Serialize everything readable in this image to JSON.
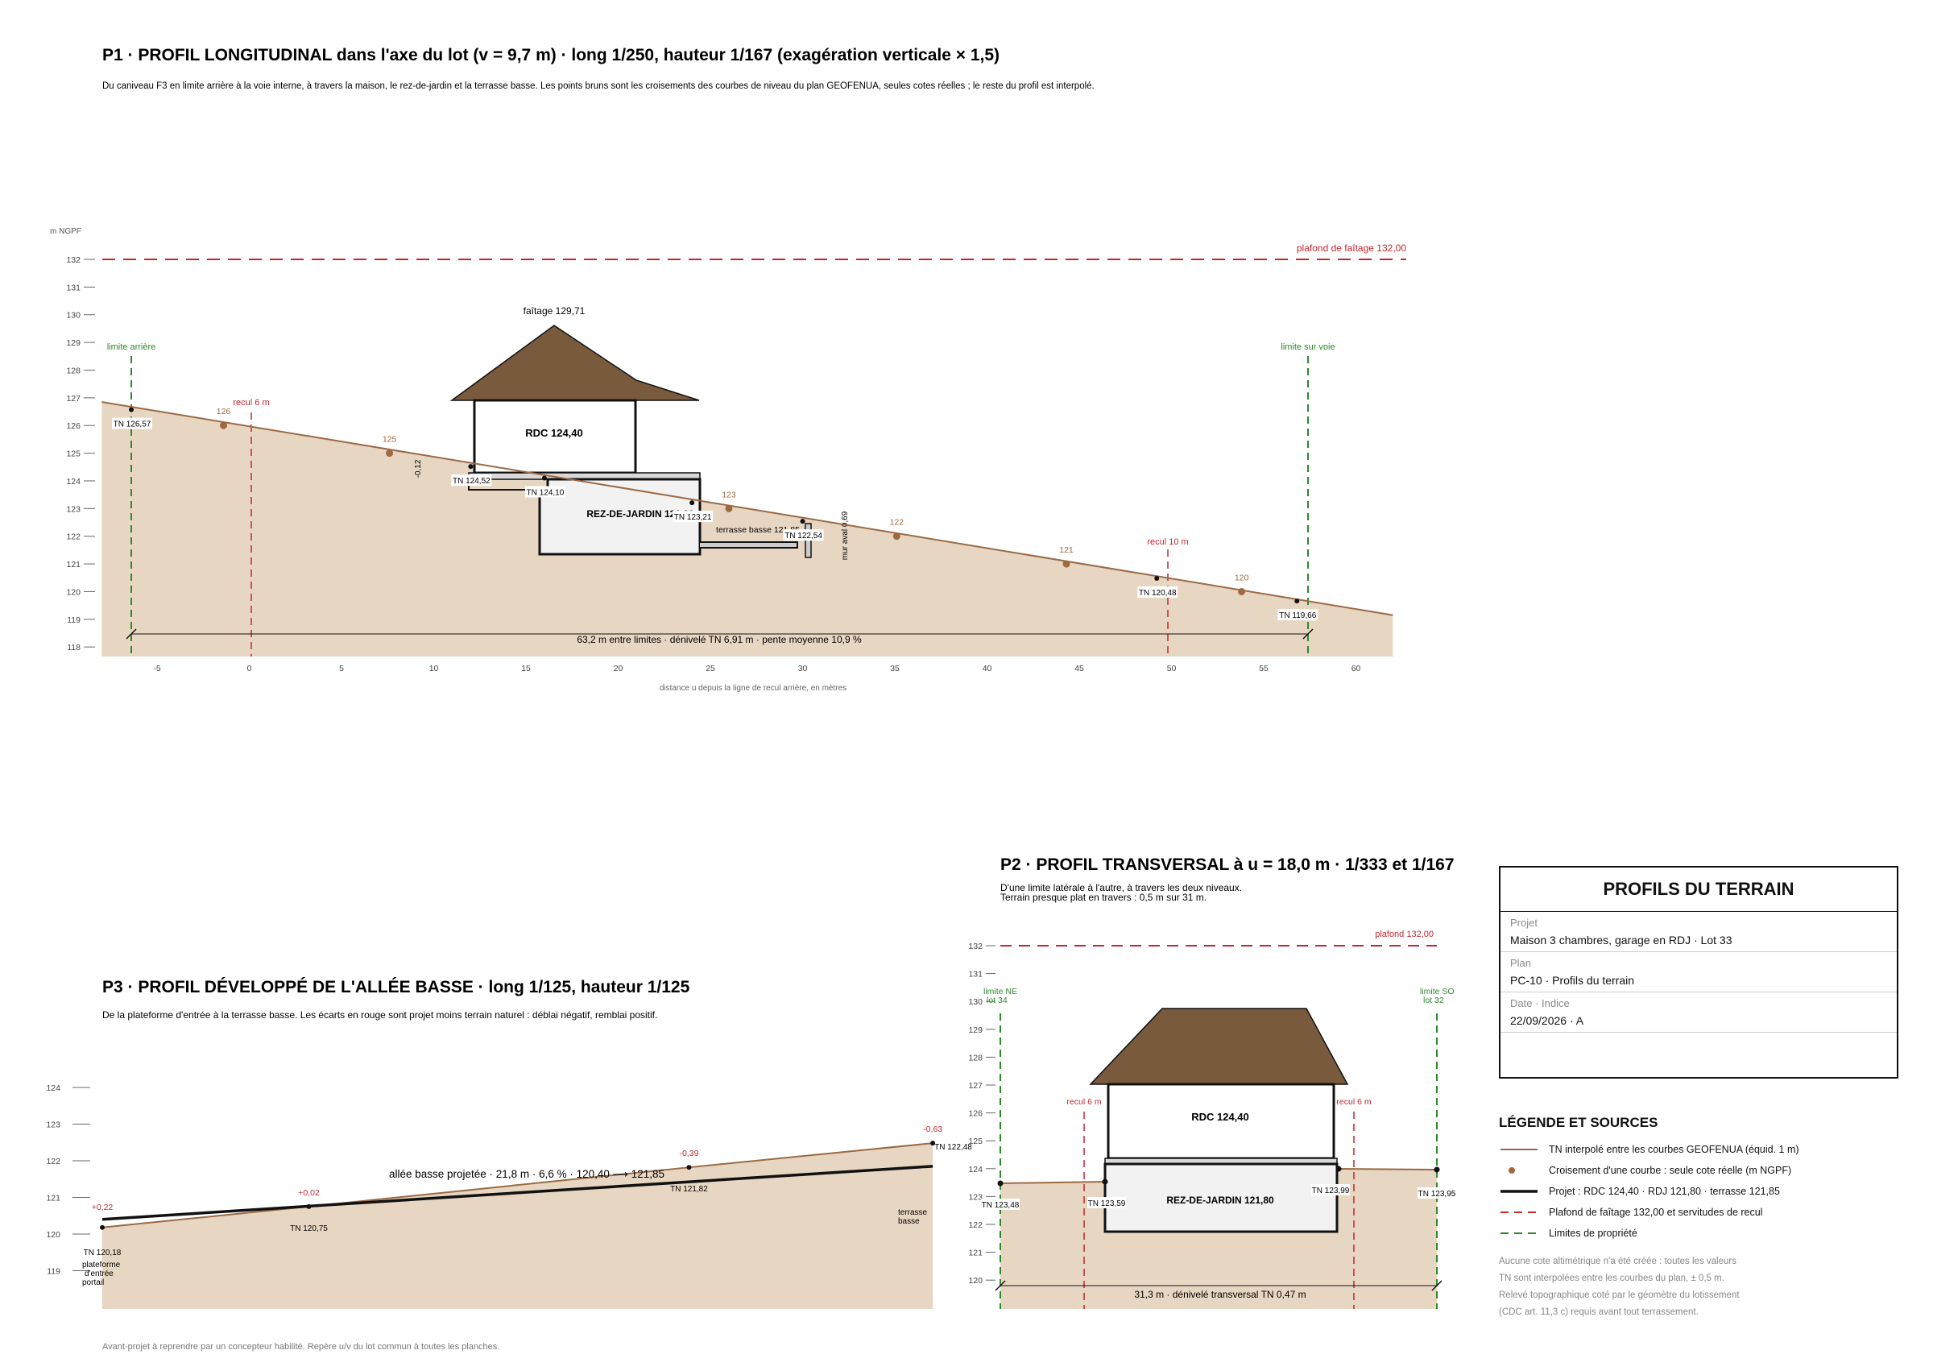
{
  "colors": {
    "tn_line": "#9b6a45",
    "ground_fill": "#e7d6c2",
    "roof": "#7a5a3c",
    "red": "#c4262e",
    "green": "#2a8a2a",
    "project": "#111111"
  },
  "p1": {
    "title": "P1 · PROFIL LONGITUDINAL dans l'axe du lot (v = 9,7 m) · long 1/250, hauteur 1/167 (exagération verticale × 1,5)",
    "subtitle": "Du caniveau F3 en limite arrière à la voie interne, à travers la maison, le rez-de-jardin et la terrasse basse. Les points bruns sont les croisements des courbes de niveau du plan GEOFENUA, seules cotes réelles ; le reste du profil est interpolé.",
    "unit": "m NGPF",
    "x_axis_label": "distance u depuis la ligne de recul arrière, en mètres",
    "chart_data": {
      "type": "line",
      "x_ticks": [
        -5,
        0,
        5,
        10,
        15,
        20,
        25,
        30,
        35,
        40,
        45,
        50,
        55,
        60
      ],
      "y_ticks": [
        118,
        119,
        120,
        121,
        122,
        123,
        124,
        125,
        126,
        127,
        128,
        129,
        130,
        131,
        132
      ],
      "xlim": [
        -8,
        62
      ],
      "ylim": [
        117.5,
        132.5
      ],
      "tn_line": {
        "x": [
          -8,
          62
        ],
        "y": [
          126.85,
          119.15
        ]
      },
      "contour_points": [
        {
          "x": -1.4,
          "y": 126,
          "label": "126"
        },
        {
          "x": 7.6,
          "y": 125,
          "label": "125"
        },
        {
          "x": 26,
          "y": 123,
          "label": "123"
        },
        {
          "x": 35.1,
          "y": 122,
          "label": "122"
        },
        {
          "x": 44.3,
          "y": 121,
          "label": "121"
        },
        {
          "x": 53.8,
          "y": 120,
          "label": "120"
        }
      ],
      "tn_labels": [
        {
          "x": -6.4,
          "y": 126.57,
          "label": "TN 126,57"
        },
        {
          "x": 12,
          "y": 124.52,
          "label": "TN 124,52"
        },
        {
          "x": 16,
          "y": 124.1,
          "label": "TN 124,10"
        },
        {
          "x": 24,
          "y": 123.21,
          "label": "TN 123,21"
        },
        {
          "x": 30,
          "y": 122.54,
          "label": "TN 122,54"
        },
        {
          "x": 49.2,
          "y": 120.48,
          "label": "TN 120,48"
        },
        {
          "x": 56.8,
          "y": 119.66,
          "label": "TN 119,66"
        }
      ],
      "cap_label": "plafond de faîtage 132,00",
      "cap": 132,
      "ridge_label": "faîtage 129,71",
      "ridge": 129.71,
      "rdc_label": "RDC 124,40",
      "rdj_label": "REZ-DE-JARDIN 121,80",
      "terrace_label": "terrasse basse 121,85",
      "wall_label": "mur aval 0,69",
      "cut_label": "-0,12",
      "limit_rear_label": "limite arrière",
      "limit_road_label": "limite sur voie",
      "recul_rear_label": "recul 6 m",
      "recul_road_label": "recul 10 m",
      "dimension_label": "63,2 m entre limites · dénivelé TN 6,91 m · pente moyenne 10,9 %"
    }
  },
  "p2": {
    "title": "P2 · PROFIL TRANSVERSAL à u = 18,0 m · 1/333 et 1/167",
    "subtitle_1": "D'une limite latérale à l'autre, à travers les deux niveaux.",
    "subtitle_2": "Terrain presque plat en travers : 0,5 m sur 31 m.",
    "chart_data": {
      "type": "line",
      "y_ticks": [
        120,
        121,
        122,
        123,
        124,
        125,
        126,
        127,
        128,
        129,
        130,
        131,
        132
      ],
      "ylim": [
        119,
        132.5
      ],
      "cap_label": "plafond 132,00",
      "limit_ne_label": "limite NE",
      "limit_ne_sub": "lot 34",
      "limit_so_label": "limite SO",
      "limit_so_sub": "lot 32",
      "recul_left_label": "recul 6 m",
      "recul_right_label": "recul 6 m",
      "rdc_label": "RDC 124,40",
      "rdj_label": "REZ-DE-JARDIN 121,80",
      "tn_labels": [
        "TN 123,48",
        "TN 123,59",
        "TN 123,99",
        "TN 123,95"
      ],
      "dimension_label": "31,3 m · dénivelé transversal TN 0,47 m"
    }
  },
  "p3": {
    "title": "P3 · PROFIL DÉVELOPPÉ DE L'ALLÉE BASSE · long 1/125, hauteur 1/125",
    "subtitle": "De la plateforme d'entrée à la terrasse basse. Les écarts en rouge sont projet moins terrain naturel : déblai négatif, remblai positif.",
    "chart_data": {
      "type": "line",
      "y_ticks": [
        119,
        120,
        121,
        122,
        123,
        124
      ],
      "ylim": [
        118.5,
        124.5
      ],
      "tn_points": [
        {
          "x": 0,
          "y": 120.18,
          "label": "TN 120,18"
        },
        {
          "x": 5.0,
          "y": 120.75,
          "label": "TN 120,75"
        },
        {
          "x": 14.2,
          "y": 121.82,
          "label": "TN 121,82"
        },
        {
          "x": 20.1,
          "y": 122.48,
          "label": "TN 122,48"
        }
      ],
      "project_points": [
        {
          "x": 0,
          "y": 120.4
        },
        {
          "x": 20.1,
          "y": 121.85
        }
      ],
      "deltas": [
        "+0,22",
        "+0,02",
        "-0,39",
        "-0,63"
      ],
      "allee_label": "allée basse projetée · 21,8 m · 6,6 % · 120,40 ⟶ 121,85",
      "start_label_1": "plateforme",
      "start_label_2": "d'entrée",
      "start_label_3": "portail",
      "end_label_1": "terrasse",
      "end_label_2": "basse"
    }
  },
  "footer": "Avant-projet à reprendre par un concepteur habilité. Repère u/v du lot commun à toutes les planches.",
  "cartouche": {
    "title": "PROFILS DU TERRAIN",
    "rows": [
      {
        "label": "Projet",
        "value": "Maison 3 chambres, garage en RDJ · Lot 33"
      },
      {
        "label": "Plan",
        "value": "PC-10 · Profils du terrain"
      },
      {
        "label": "Date · Indice",
        "value": "22/09/2026 · A"
      }
    ]
  },
  "legend": {
    "title": "LÉGENDE ET SOURCES",
    "items": [
      {
        "symbol": "tn",
        "label": "TN interpolé entre les courbes GEOFENUA (équid. 1 m)"
      },
      {
        "symbol": "dot",
        "label": "Croisement d'une courbe : seule cote réelle (m NGPF)"
      },
      {
        "symbol": "project",
        "label": "Projet : RDC 124,40 · RDJ 121,80 · terrasse 121,85"
      },
      {
        "symbol": "red-dash",
        "label": "Plafond de faîtage 132,00 et servitudes de recul"
      },
      {
        "symbol": "green-dash",
        "label": "Limites de propriété"
      }
    ],
    "notes": [
      "Aucune cote altimétrique n'a été créée : toutes les valeurs",
      "TN sont interpolées entre les courbes du plan, ± 0,5 m.",
      "Relevé topographique coté par le géomètre du lotissement",
      "(CDC art. 11,3 c) requis avant tout terrassement."
    ]
  }
}
